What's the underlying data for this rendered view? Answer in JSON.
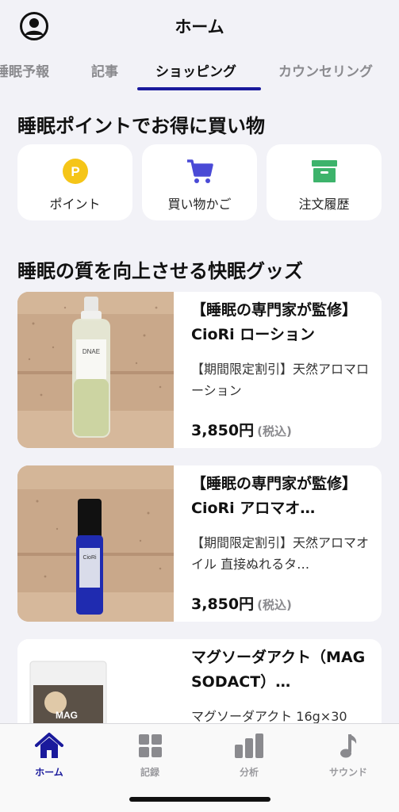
{
  "header": {
    "title": "ホーム"
  },
  "tabs": [
    {
      "label": "睡眠予報"
    },
    {
      "label": "記事"
    },
    {
      "label": "ショッピング"
    },
    {
      "label": "カウンセリング"
    }
  ],
  "shop": {
    "title": "睡眠ポイントでお得に買い物",
    "quick_links": [
      {
        "label": "ポイント",
        "icon": "point-coin-icon"
      },
      {
        "label": "買い物かご",
        "icon": "cart-icon"
      },
      {
        "label": "注文履歴",
        "icon": "archive-box-icon"
      }
    ]
  },
  "goods": {
    "title": "睡眠の質を向上させる快眠グッズ",
    "products": [
      {
        "name": "【睡眠の専門家が監修】CioRi ローション",
        "desc": "【期間限定割引】天然アロマローション",
        "price": "3,850円",
        "tax": "(税込)"
      },
      {
        "name": "【睡眠の専門家が監修】CioRi アロマオ…",
        "desc": "【期間限定割引】天然アロマオイル 直接ぬれるタ…",
        "price": "3,850円",
        "tax": "(税込)"
      },
      {
        "name": "マグソーダアクト（MAG SODACT）…",
        "desc": "マグソーダアクト 16g×30",
        "price": "",
        "tax": ""
      }
    ]
  },
  "bottom_nav": [
    {
      "label": "ホーム",
      "icon": "home-icon"
    },
    {
      "label": "記録",
      "icon": "grid-icon"
    },
    {
      "label": "分析",
      "icon": "bar-chart-icon"
    },
    {
      "label": "サウンド",
      "icon": "music-note-icon"
    }
  ],
  "colors": {
    "accent": "#1a1a9c",
    "point": "#f5c518",
    "cart": "#4a4ad6",
    "history": "#3db36b"
  }
}
